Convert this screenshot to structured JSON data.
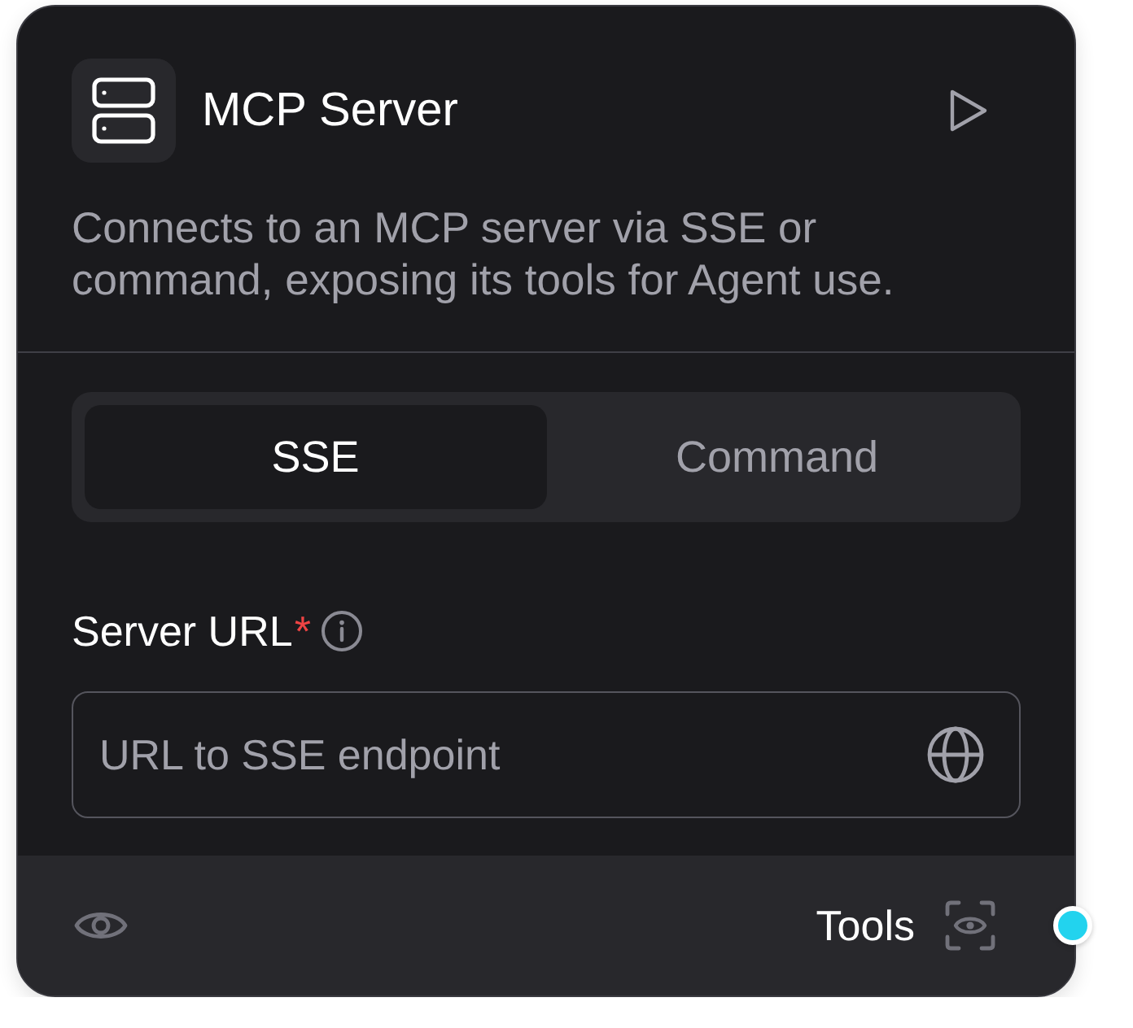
{
  "node": {
    "title": "MCP Server",
    "description": "Connects to an MCP server via SSE or command, exposing its tools for Agent use."
  },
  "mode_tabs": [
    {
      "label": "SSE",
      "selected": true
    },
    {
      "label": "Command",
      "selected": false
    }
  ],
  "server_url": {
    "label": "Server URL",
    "required_mark": "*",
    "placeholder": "URL to SSE endpoint"
  },
  "footer": {
    "output_label": "Tools"
  }
}
